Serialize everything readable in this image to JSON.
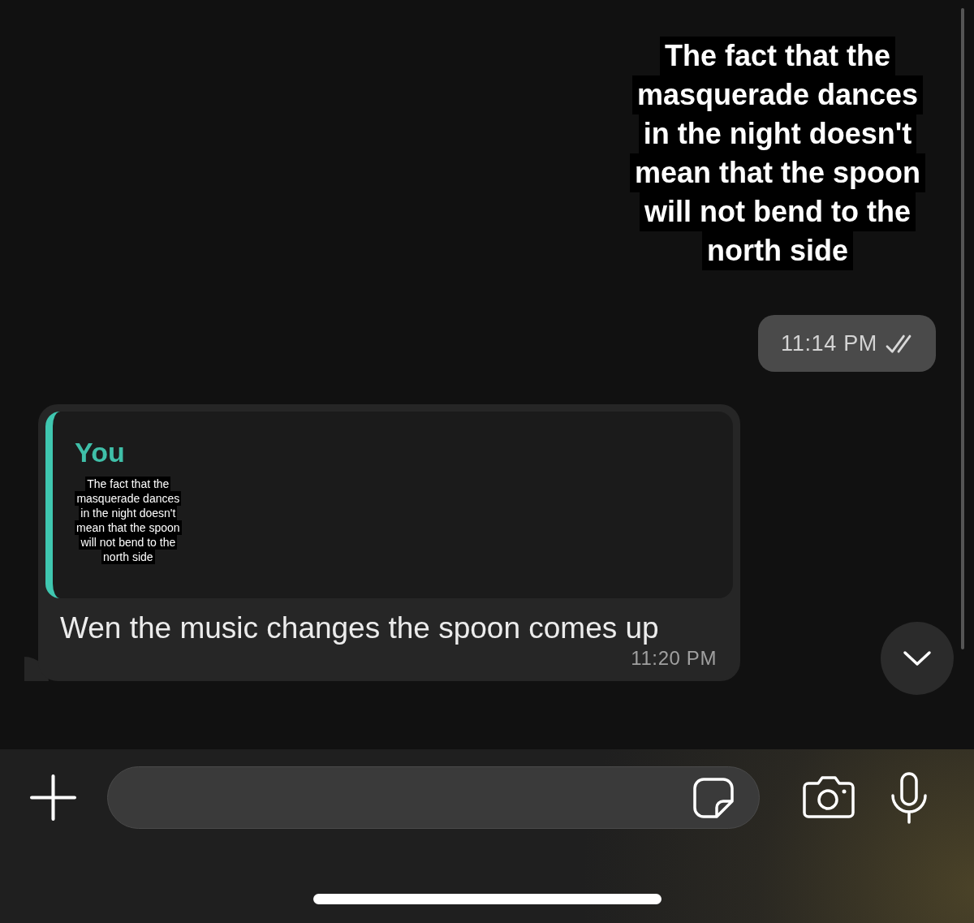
{
  "messages": [
    {
      "kind": "sticker",
      "lines": [
        "The fact that the",
        "masquerade dances",
        "in the night doesn't",
        "mean that the spoon",
        "will not bend to the",
        "north side"
      ],
      "time": "11:14 PM",
      "read": false
    },
    {
      "kind": "reply",
      "quote": {
        "author": "You",
        "lines": [
          "The fact that the",
          "masquerade dances",
          "in the night doesn't",
          "mean that the spoon",
          "will not bend to the",
          "north side"
        ]
      },
      "text": "Wen the music changes the spoon comes up",
      "time": "11:20 PM"
    }
  ]
}
